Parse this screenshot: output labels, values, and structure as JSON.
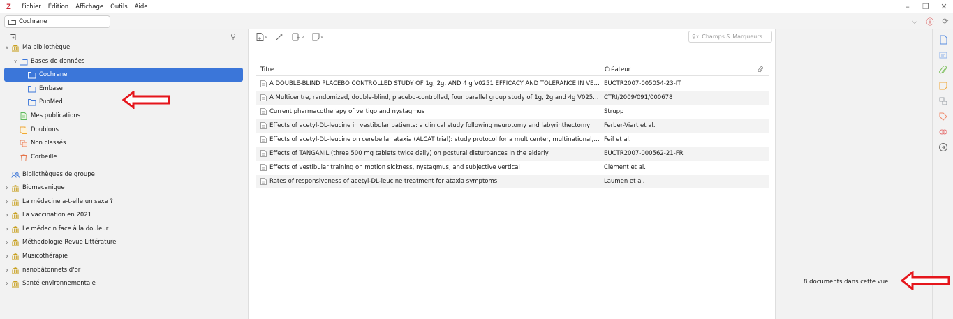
{
  "menubar": {
    "logo": "Z",
    "items": [
      "Fichier",
      "Édition",
      "Affichage",
      "Outils",
      "Aide"
    ]
  },
  "tab": {
    "label": "Cochrane"
  },
  "left_tree": [
    {
      "label": "Ma bibliothèque",
      "icon": "library-icon",
      "twisty": "expanded",
      "indent": 0
    },
    {
      "label": "Bases de données",
      "icon": "folder-icon",
      "twisty": "expanded",
      "indent": 1
    },
    {
      "label": "Cochrane",
      "icon": "folder-icon",
      "twisty": "",
      "indent": 2,
      "selected": true
    },
    {
      "label": "Embase",
      "icon": "folder-icon",
      "twisty": "",
      "indent": 2
    },
    {
      "label": "PubMed",
      "icon": "folder-icon",
      "twisty": "",
      "indent": 2
    },
    {
      "label": "Mes publications",
      "icon": "my-publications-icon",
      "twisty": "",
      "indent": 1
    },
    {
      "label": "Doublons",
      "icon": "duplicates-icon",
      "twisty": "",
      "indent": 1
    },
    {
      "label": "Non classés",
      "icon": "unfiled-icon",
      "twisty": "",
      "indent": 1
    },
    {
      "label": "Corbeille",
      "icon": "trash-icon",
      "twisty": "",
      "indent": 1
    },
    {
      "label": "Bibliothèques de groupe",
      "icon": "group-libraries-icon",
      "twisty": "",
      "indent": 0,
      "gap": true
    },
    {
      "label": "Biomecanique",
      "icon": "library-icon",
      "twisty": "collapsed",
      "indent": 0
    },
    {
      "label": "La médecine a-t-elle un sexe ?",
      "icon": "library-icon",
      "twisty": "collapsed",
      "indent": 0
    },
    {
      "label": "La vaccination en 2021",
      "icon": "library-icon",
      "twisty": "collapsed",
      "indent": 0
    },
    {
      "label": "Le médecin face à la douleur",
      "icon": "library-icon",
      "twisty": "collapsed",
      "indent": 0
    },
    {
      "label": "Méthodologie Revue Littérature",
      "icon": "library-icon",
      "twisty": "collapsed",
      "indent": 0
    },
    {
      "label": "Musicothérapie",
      "icon": "library-icon",
      "twisty": "collapsed",
      "indent": 0
    },
    {
      "label": "nanobâtonnets d'or",
      "icon": "library-icon",
      "twisty": "collapsed",
      "indent": 0
    },
    {
      "label": "Santé environnementale",
      "icon": "library-icon",
      "twisty": "collapsed",
      "indent": 0
    }
  ],
  "search": {
    "placeholder": "Champs & Marqueurs"
  },
  "table": {
    "columns": {
      "title": "Titre",
      "creator": "Créateur"
    },
    "rows": [
      {
        "title": "A DOUBLE-BLIND PLACEBO CONTROLLED STUDY OF 1g, 2g, AND 4 g V0251 EFFICACY AND TOLERANCE IN VEST...",
        "creator": "EUCTR2007-005054-23-IT"
      },
      {
        "title": "A Multicentre, randomized, double-blind, placebo-controlled, four parallel group study of 1g, 2g and 4g V0251 ...",
        "creator": "CTRI/2009/091/000678"
      },
      {
        "title": "Current pharmacotherapy of vertigo and nystagmus",
        "creator": "Strupp"
      },
      {
        "title": "Effects of acetyl-DL-leucine in vestibular patients: a clinical study following neurotomy and labyrinthectomy",
        "creator": "Ferber-Viart et al."
      },
      {
        "title": "Effects of acetyl-DL-leucine on cerebellar ataxia (ALCAT trial): study protocol for a multicenter, multinational, ran...",
        "creator": "Feil et al."
      },
      {
        "title": "Effects of TANGANIL (three 500 mg tablets twice daily) on postural disturbances in the elderly",
        "creator": "EUCTR2007-000562-21-FR"
      },
      {
        "title": "Effects of vestibular training on motion sickness, nystagmus, and subjective vertical",
        "creator": "Clément et al."
      },
      {
        "title": "Rates of responsiveness of acetyl-DL-leucine treatment for ataxia symptoms",
        "creator": "Laumen et al."
      }
    ]
  },
  "item_pane": {
    "count_text": "8 documents dans cette vue"
  },
  "colors": {
    "selection": "#3b76d9",
    "annotation_arrow": "#e5161c",
    "logo": "#cc2936",
    "folder": "#3b76d9",
    "library": "#c8a020"
  }
}
